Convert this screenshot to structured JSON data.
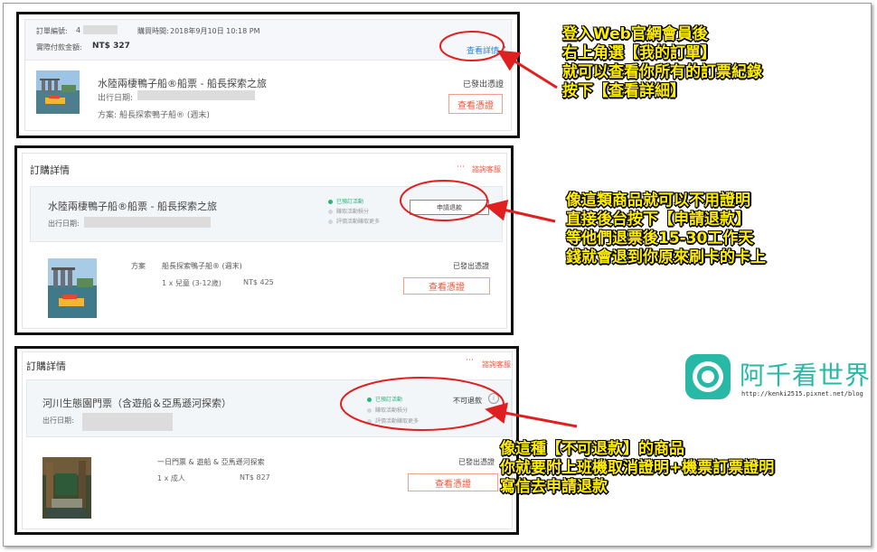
{
  "panel1": {
    "order_no_label": "訂單編號:",
    "order_no_prefix": "4",
    "purchase_time_label": "購買時間:",
    "purchase_time": "2018年9月10日 10:18 PM",
    "paid_label": "實際付款金額:",
    "paid_amount": "NT$ 327",
    "view_details_link": "查看詳情",
    "product_title": "水陸兩棲鴨子船®船票 - 船長探索之旅",
    "travel_date_label": "出行日期:",
    "plan_label": "方案:",
    "plan_value": "船長探索鴨子船® (週末)",
    "status": "已發出憑證",
    "view_voucher_button": "查看憑證"
  },
  "panel2": {
    "header_title": "訂購詳情",
    "contact_link": "諮詢客服",
    "product_title": "水陸兩棲鴨子船®船票 - 船長探索之旅",
    "travel_date_label": "出行日期:",
    "steps": [
      "已預訂活動",
      "賺取活動積分",
      "評價活動賺取更多"
    ],
    "refund_button": "申請退款",
    "plan_label": "方案",
    "plan_value": "船長探索鴨子船® (週末)",
    "qty_line": "1 x 兒童 (3-12歲)",
    "price": "NT$ 425",
    "status": "已發出憑證",
    "view_voucher_button": "查看憑證"
  },
  "panel3": {
    "header_title": "訂購詳情",
    "contact_link": "諮詢客服",
    "product_title": "河川生態園門票（含遊船＆亞馬遜河探索）",
    "travel_date_label": "出行日期:",
    "steps": [
      "已預訂活動",
      "賺取活動積分",
      "評價活動賺取更多"
    ],
    "non_refundable": "不可退款",
    "plan_value": "一日門票 & 遊船 & 亞馬遜河探索",
    "qty_line": "1 x 成人",
    "price": "NT$ 827",
    "status": "已發出憑證",
    "view_voucher_button": "查看憑證"
  },
  "annotations": {
    "note1": [
      "登入Web官網會員後",
      "右上角選【我的訂單】",
      "就可以查看你所有的訂票紀錄",
      "按下【查看詳細】"
    ],
    "note2": [
      "像這類商品就可以不用證明",
      "直接後台按下【申請退款】",
      "等他們退票後15-30工作天",
      "錢就會退到你原來刷卡的卡上"
    ],
    "note3": [
      "像這種【不可退款】的商品",
      "你就要附上班機取消證明+機票訂票證明",
      "寫信去申請退款"
    ]
  },
  "logo": {
    "text": "阿千看世界",
    "url": "http://kenki2515.pixnet.net/blog"
  },
  "colors": {
    "accent": "#e8553a",
    "annotation_red": "#e02020",
    "step_green": "#2bb37a",
    "link_blue": "#1e88d6",
    "logo_teal": "#27b8a6",
    "note_yellow": "#ffee00"
  }
}
